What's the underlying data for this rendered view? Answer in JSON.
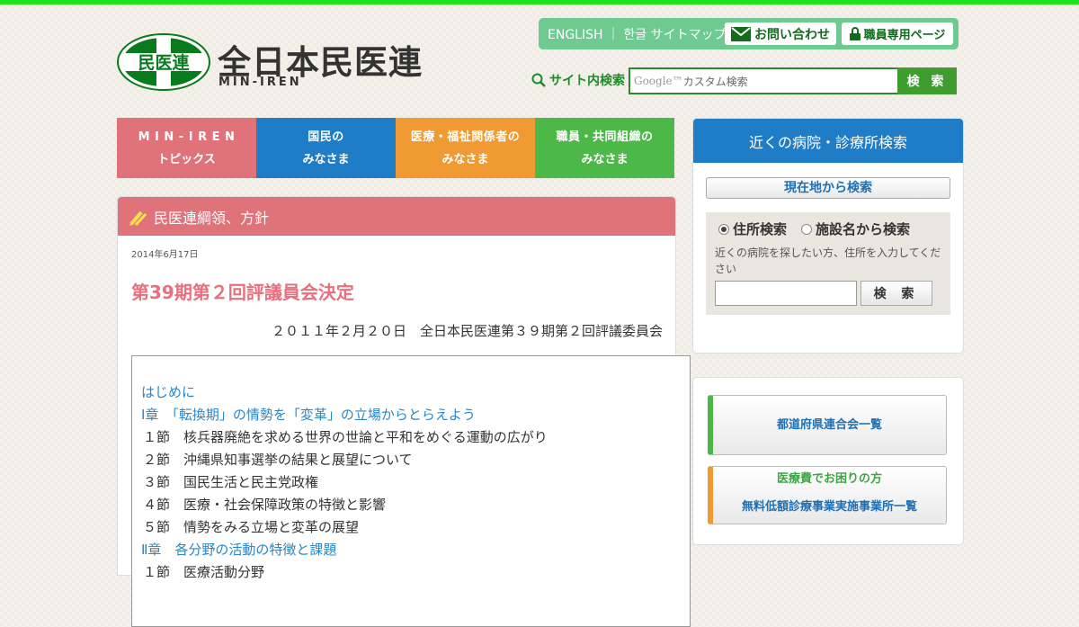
{
  "colors": {
    "top_bar": "#1ee21e",
    "brand_green": "#0a7a1e",
    "nav_topics": "#e0727a",
    "nav_citizens": "#1f7cc7",
    "nav_medical": "#ef9a33",
    "nav_staff": "#4cb848",
    "article_title": "#e86f7d",
    "link_blue": "#2a86c8"
  },
  "logo": {
    "badge_text": "民医連",
    "title": "全日本民医連",
    "subtitle": "MIN-IREN"
  },
  "utility": {
    "english": "ENGLISH",
    "sep": "｜",
    "korean": "한글",
    "sitemap": "サイトマップ",
    "contact": "お問い合わせ",
    "contact_icon": "mail-icon",
    "staff": "職員専用ページ",
    "staff_icon": "lock-icon"
  },
  "site_search": {
    "label": "サイト内検索",
    "icon": "search-icon",
    "placeholder": "カスタム検索",
    "google_text": "Google™",
    "button": "検 索"
  },
  "nav": {
    "items": [
      {
        "line1": "M I N - I R E N",
        "line2": "トピックス"
      },
      {
        "line1": "国民の",
        "line2": "みなさま"
      },
      {
        "line1": "医療・福祉関係者の",
        "line2": "みなさま"
      },
      {
        "line1": "職員・共同組織の",
        "line2": "みなさま"
      }
    ]
  },
  "article": {
    "category": "民医連綱領、方針",
    "category_icon": "pencil-icon",
    "date": "2014年6月17日",
    "title": "第39期第２回評議員会決定",
    "meta": "２０１１年２月２０日　全日本民医連第３９期第２回評議委員会",
    "toc": [
      {
        "text": "はじめに",
        "type": "link"
      },
      {
        "text": "Ⅰ章　「転換期」の情勢を「変革」の立場からとらえよう",
        "type": "link"
      },
      {
        "text": "１節　核兵器廃絶を求める世界の世論と平和をめぐる運動の広がり",
        "type": "sec"
      },
      {
        "text": "２節　沖縄県知事選挙の結果と展望について",
        "type": "sec"
      },
      {
        "text": "３節　国民生活と民主党政権",
        "type": "sec"
      },
      {
        "text": "４節　医療・社会保障政策の特徴と影響",
        "type": "sec"
      },
      {
        "text": "５節　情勢をみる立場と変革の展望",
        "type": "sec"
      },
      {
        "text": "Ⅱ章　各分野の活動の特徴と課題",
        "type": "link"
      },
      {
        "text": "１節　医療活動分野",
        "type": "sec"
      }
    ]
  },
  "side_search": {
    "title": "近くの病院・診療所検索",
    "location_button": "現在地から検索",
    "radio_address": "住所検索",
    "radio_facility": "施設名から検索",
    "description": "近くの病院を探したい方、住所を入力してください",
    "address_value": "",
    "button": "検 索"
  },
  "side_links": {
    "prefectures": "都道府県連合会一覧",
    "lowcost_line1": "医療費でお困りの方",
    "lowcost_line2": "無料低額診療事業実施事業所一覧"
  }
}
